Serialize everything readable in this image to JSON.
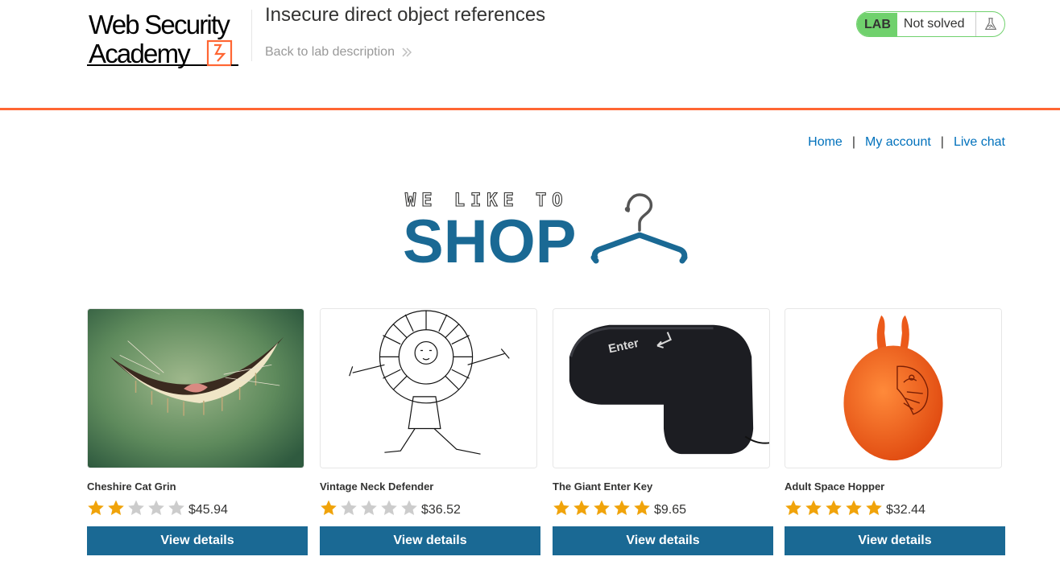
{
  "header": {
    "logo_line1": "Web Security",
    "logo_line2": "Academy",
    "lab_title": "Insecure direct object references",
    "back_link": "Back to lab description",
    "lab_badge": "LAB",
    "lab_status": "Not solved"
  },
  "nav": {
    "home": "Home",
    "account": "My account",
    "chat": "Live chat",
    "separator": "|"
  },
  "banner": {
    "line1": "WE LIKE TO",
    "line2": "SHOP"
  },
  "products": [
    {
      "name": "Cheshire Cat Grin",
      "rating": 2,
      "max_rating": 5,
      "price": "$45.94",
      "button": "View details"
    },
    {
      "name": "Vintage Neck Defender",
      "rating": 1,
      "max_rating": 5,
      "price": "$36.52",
      "button": "View details"
    },
    {
      "name": "The Giant Enter Key",
      "rating": 5,
      "max_rating": 5,
      "price": "$9.65",
      "button": "View details"
    },
    {
      "name": "Adult Space Hopper",
      "rating": 5,
      "max_rating": 5,
      "price": "$32.44",
      "button": "View details"
    }
  ],
  "colors": {
    "accent_orange": "#ff6633",
    "link_blue": "#0071bc",
    "button_blue": "#1a6994",
    "lab_green": "#70d16d",
    "star_gold": "#f0a30a",
    "star_gray": "#cccccc"
  },
  "icons": {
    "back": "double-chevron-right-icon",
    "lab": "flask-icon",
    "star": "star-icon"
  }
}
